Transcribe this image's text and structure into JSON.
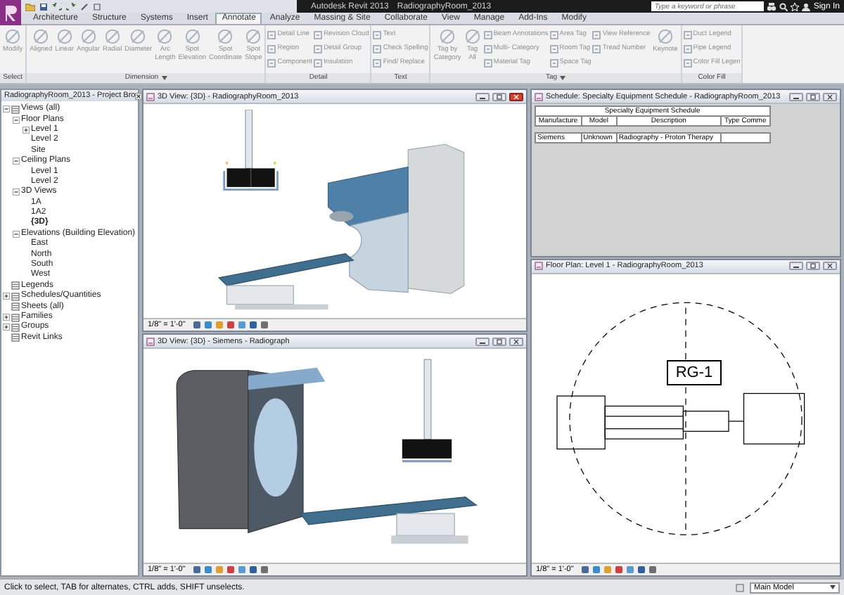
{
  "title_bar": {
    "app_title": "Autodesk Revit 2013",
    "document_title": "RadiographyRoom_2013",
    "search": {
      "placeholder": "Type a keyword or phrase"
    },
    "sign_in": "Sign In"
  },
  "tabs": [
    {
      "label": "Architecture",
      "selected": false
    },
    {
      "label": "Structure",
      "selected": false
    },
    {
      "label": "Systems",
      "selected": false
    },
    {
      "label": "Insert",
      "selected": false
    },
    {
      "label": "Annotate",
      "selected": true
    },
    {
      "label": "Analyze",
      "selected": false
    },
    {
      "label": "Massing & Site",
      "selected": false
    },
    {
      "label": "Collaborate",
      "selected": false
    },
    {
      "label": "View",
      "selected": false
    },
    {
      "label": "Manage",
      "selected": false
    },
    {
      "label": "Add-Ins",
      "selected": false
    },
    {
      "label": "Modify",
      "selected": false
    }
  ],
  "ribbon": [
    {
      "title": "Select",
      "has_dropdown": false,
      "groups": [
        {
          "kind": "large",
          "items": [
            "Modify"
          ]
        }
      ]
    },
    {
      "title": "Dimension",
      "has_dropdown": true,
      "groups": [
        {
          "kind": "large",
          "items": [
            "Aligned",
            "Linear",
            "Angular",
            "Radial",
            "Diameter",
            "Arc Length",
            "Spot Elevation",
            "Spot Coordinate",
            "Spot Slope"
          ]
        }
      ]
    },
    {
      "title": "Detail",
      "has_dropdown": false,
      "groups": [
        {
          "kind": "small",
          "items": [
            "Detail Line",
            "Region",
            "Component"
          ]
        },
        {
          "kind": "small",
          "items": [
            "Revision Cloud",
            "Detail Group",
            "Insulation"
          ]
        }
      ]
    },
    {
      "title": "Text",
      "has_dropdown": false,
      "groups": [
        {
          "kind": "small",
          "items": [
            "Text",
            "Check Spelling",
            "Find/ Replace"
          ]
        }
      ]
    },
    {
      "title": "Tag",
      "has_dropdown": true,
      "groups": [
        {
          "kind": "large",
          "items": [
            "Tag by Category",
            "Tag All"
          ]
        },
        {
          "kind": "small",
          "items": [
            "Beam Annotations",
            "Multi- Category",
            "Material Tag"
          ]
        },
        {
          "kind": "small",
          "items": [
            "Area Tag",
            "Room Tag",
            "Space Tag"
          ]
        },
        {
          "kind": "small",
          "items": [
            "View Reference",
            "Tread Number"
          ]
        },
        {
          "kind": "large",
          "items": [
            "Keynote"
          ]
        }
      ]
    },
    {
      "title": "Color Fill",
      "has_dropdown": false,
      "groups": [
        {
          "kind": "small",
          "items": [
            "Duct Legend",
            "Pipe Legend",
            "Color Fill Legen"
          ]
        }
      ]
    }
  ],
  "project_browser": {
    "title": "RadiographyRoom_2013 - Project Bro",
    "tree": [
      {
        "label": "Views (all)",
        "expanded": true,
        "children": [
          {
            "label": "Floor Plans",
            "expanded": true,
            "children": [
              {
                "label": "Level 1",
                "expanded": false
              },
              {
                "label": "Level 2"
              },
              {
                "label": "Site"
              }
            ]
          },
          {
            "label": "Ceiling Plans",
            "expanded": true,
            "children": [
              {
                "label": "Level 1"
              },
              {
                "label": "Level 2"
              }
            ]
          },
          {
            "label": "3D Views",
            "expanded": true,
            "children": [
              {
                "label": "1A",
                "current": false
              },
              {
                "label": "1A2",
                "current": false
              },
              {
                "label": "{3D}",
                "current": true
              }
            ]
          },
          {
            "label": "Elevations (Building Elevation)",
            "expanded": true,
            "children": [
              {
                "label": "East"
              },
              {
                "label": "North"
              },
              {
                "label": "South"
              },
              {
                "label": "West"
              }
            ]
          }
        ]
      },
      {
        "label": "Legends"
      },
      {
        "label": "Schedules/Quantities",
        "expanded": false
      },
      {
        "label": "Sheets (all)"
      },
      {
        "label": "Families",
        "expanded": false
      },
      {
        "label": "Groups",
        "expanded": false
      },
      {
        "label": "Revit Links"
      }
    ]
  },
  "views": [
    {
      "kind": "front3d",
      "title": "3D View: {3D} - RadiographyRoom_2013",
      "active": true,
      "scale": "1/8\" = 1'-0\""
    },
    {
      "kind": "side3d",
      "title": "3D View: {3D} - Siemens - Radiograph",
      "active": false,
      "scale": "1/8\" = 1'-0\""
    },
    {
      "kind": "schedule",
      "title": "Schedule: Specialty Equipment Schedule - RadiographyRoom_2013",
      "active": false,
      "schedule": {
        "heading": "Specialty Equipment Schedule",
        "columns": [
          "Manufacture",
          "Model",
          "Description",
          "Type Comme"
        ],
        "rows": [
          [
            "Siemens",
            "Unknown",
            "Radiography - Proton Therapy"
          ]
        ]
      }
    },
    {
      "kind": "plan",
      "title": "Floor Plan: Level 1 - RadiographyRoom_2013",
      "active": false,
      "tag": "RG-1",
      "scale": "1/8\" = 1'-0\""
    }
  ],
  "status_bar": {
    "message": "Click to select, TAB for alternates, CTRL adds, SHIFT unselects.",
    "model": "Main Model"
  }
}
